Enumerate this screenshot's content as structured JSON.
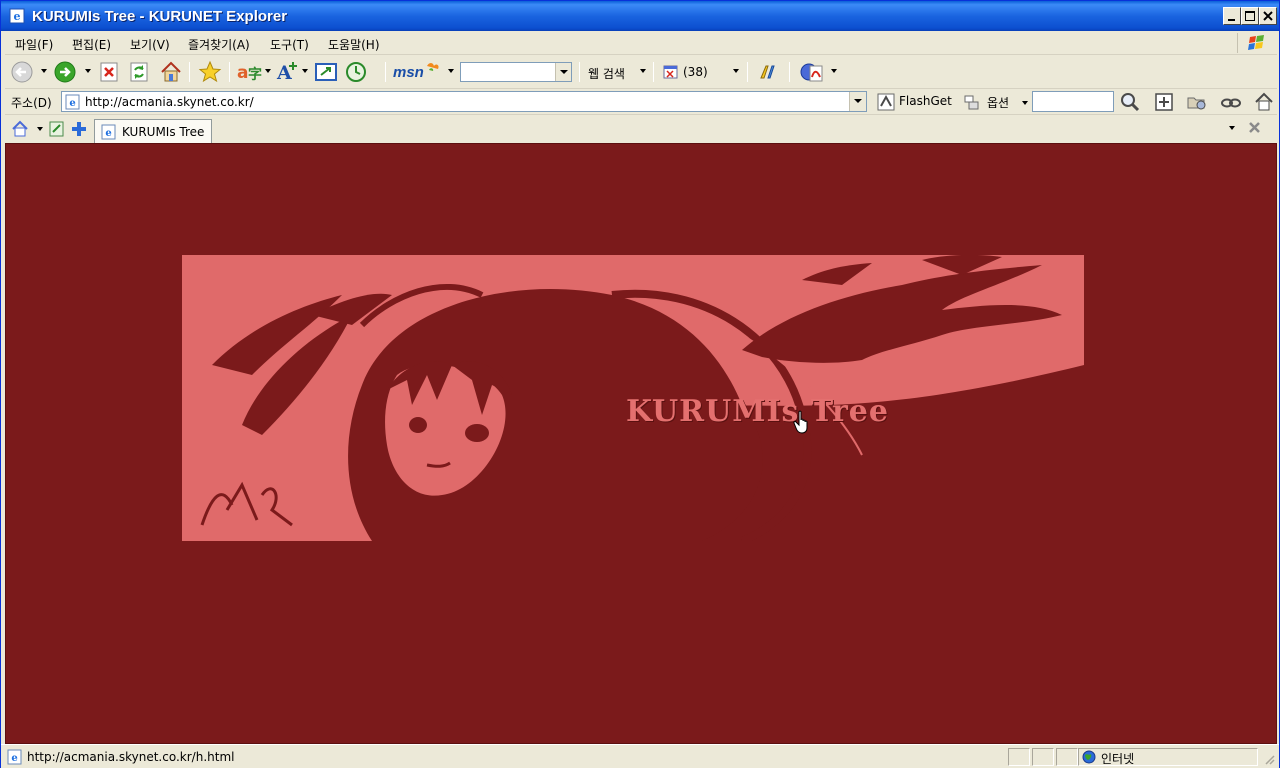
{
  "window": {
    "title": "KURUMIs Tree - KURUNET Explorer"
  },
  "menu": {
    "items": [
      "파일(F)",
      "편집(E)",
      "보기(V)",
      "즐겨찾기(A)",
      "도구(T)",
      "도움말(H)"
    ]
  },
  "toolbar": {
    "msn_label": "msn",
    "web_search_label": "웹 검색",
    "blocked_count": "(38)"
  },
  "address": {
    "label": "주소(D)",
    "url": "http://acmania.skynet.co.kr/",
    "flashget_label": "FlashGet",
    "options_label": "옵션",
    "search_value": ""
  },
  "tabs": [
    {
      "label": "KURUMIs Tree"
    }
  ],
  "page": {
    "banner_title": "KURUMIs Tree",
    "background_color": "#7b1a1b",
    "banner_color": "#e06a6a"
  },
  "status": {
    "text": "http://acmania.skynet.co.kr/h.html",
    "zone": "인터넷"
  },
  "icons": {
    "back": "back-arrow-icon",
    "forward": "forward-arrow-icon",
    "stop": "stop-icon",
    "refresh": "refresh-icon",
    "home": "home-icon",
    "favorites": "star-icon"
  }
}
